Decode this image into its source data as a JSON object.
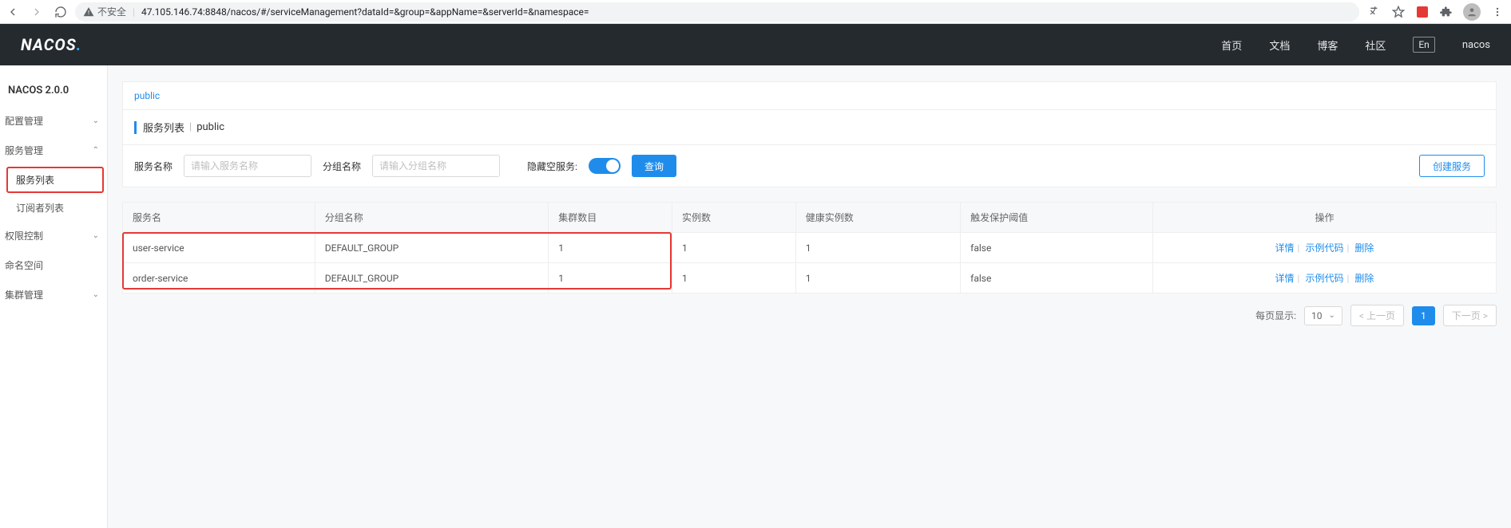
{
  "browser": {
    "insecure_label": "不安全",
    "url": "47.105.146.74:8848/nacos/#/serviceManagement?dataId=&group=&appName=&serverId=&namespace="
  },
  "topbar": {
    "logo_main": "NACOS",
    "logo_dot": ".",
    "links": {
      "home": "首页",
      "docs": "文档",
      "blog": "博客",
      "community": "社区"
    },
    "lang": "En",
    "user": "nacos"
  },
  "sidebar": {
    "title": "NACOS 2.0.0",
    "config_mgmt": "配置管理",
    "service_mgmt": "服务管理",
    "service_list": "服务列表",
    "subscriber_list": "订阅者列表",
    "auth": "权限控制",
    "namespace": "命名空间",
    "cluster": "集群管理"
  },
  "namespace_tab": "public",
  "page_title": {
    "title": "服务列表",
    "ns": "public"
  },
  "filters": {
    "service_name_label": "服务名称",
    "service_name_placeholder": "请输入服务名称",
    "group_name_label": "分组名称",
    "group_name_placeholder": "请输入分组名称",
    "hide_empty_label": "隐藏空服务:",
    "search_btn": "查询",
    "create_btn": "创建服务"
  },
  "table": {
    "headers": {
      "name": "服务名",
      "group": "分组名称",
      "clusters": "集群数目",
      "instances": "实例数",
      "healthy": "健康实例数",
      "threshold": "触发保护阈值",
      "ops": "操作"
    },
    "ops_labels": {
      "detail": "详情",
      "sample": "示例代码",
      "delete": "删除"
    },
    "rows": [
      {
        "name": "user-service",
        "group": "DEFAULT_GROUP",
        "clusters": "1",
        "instances": "1",
        "healthy": "1",
        "threshold": "false"
      },
      {
        "name": "order-service",
        "group": "DEFAULT_GROUP",
        "clusters": "1",
        "instances": "1",
        "healthy": "1",
        "threshold": "false"
      }
    ]
  },
  "pager": {
    "per_page_label": "每页显示:",
    "per_page_value": "10",
    "prev": "< 上一页",
    "page": "1",
    "next": "下一页 >"
  }
}
